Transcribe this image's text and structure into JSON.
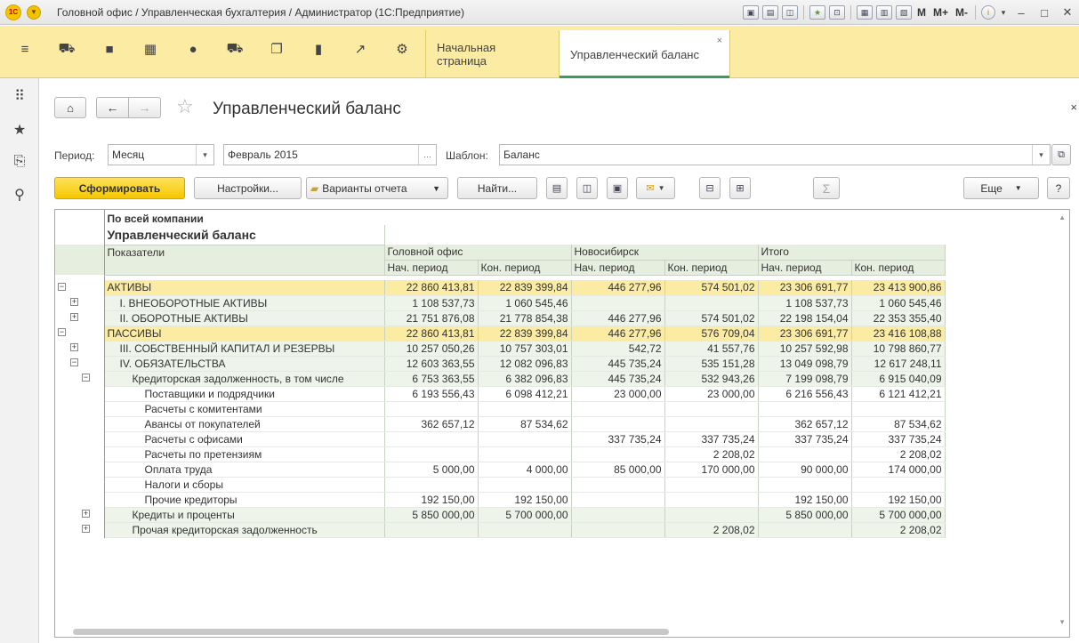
{
  "window": {
    "title": "Головной офис / Управленческая бухгалтерия / Администратор  (1С:Предприятие)",
    "logo_text": "1С",
    "tools": [
      "M",
      "M+",
      "M-"
    ]
  },
  "sections": {
    "tabs": [
      {
        "label": "Начальная страница"
      },
      {
        "label": "Управленческий баланс"
      }
    ]
  },
  "form": {
    "title": "Управленческий баланс",
    "period_label": "Период:",
    "period_type": "Месяц",
    "period_value": "Февраль 2015",
    "template_label": "Шаблон:",
    "template_value": "Баланс",
    "buttons": {
      "generate": "Сформировать",
      "settings": "Настройки...",
      "variants": "Варианты отчета",
      "find": "Найти...",
      "more": "Еще",
      "help": "?"
    }
  },
  "report": {
    "company": "По всей компании",
    "title": "Управленческий баланс",
    "indicators_header": "Показатели",
    "column_groups": [
      "Головной офис",
      "Новосибирск",
      "Итого"
    ],
    "sub_columns": [
      "Нач. период",
      "Кон. период"
    ],
    "rows": [
      {
        "label": "АКТИВЫ",
        "values": [
          "22 860 413,81",
          "22 839 399,84",
          "446 277,96",
          "574 501,02",
          "23 306 691,77",
          "23 413 900,86"
        ]
      },
      {
        "label": "I. ВНЕОБОРОТНЫЕ АКТИВЫ",
        "values": [
          "1 108 537,73",
          "1 060 545,46",
          "",
          "",
          "1 108 537,73",
          "1 060 545,46"
        ]
      },
      {
        "label": "II. ОБОРОТНЫЕ АКТИВЫ",
        "values": [
          "21 751 876,08",
          "21 778 854,38",
          "446 277,96",
          "574 501,02",
          "22 198 154,04",
          "22 353 355,40"
        ]
      },
      {
        "label": "ПАССИВЫ",
        "values": [
          "22 860 413,81",
          "22 839 399,84",
          "446 277,96",
          "576 709,04",
          "23 306 691,77",
          "23 416 108,88"
        ]
      },
      {
        "label": "III. СОБСТВЕННЫЙ КАПИТАЛ И РЕЗЕРВЫ",
        "values": [
          "10 257 050,26",
          "10 757 303,01",
          "542,72",
          "41 557,76",
          "10 257 592,98",
          "10 798 860,77"
        ]
      },
      {
        "label": "IV. ОБЯЗАТЕЛЬСТВА",
        "values": [
          "12 603 363,55",
          "12 082 096,83",
          "445 735,24",
          "535 151,28",
          "13 049 098,79",
          "12 617 248,11"
        ]
      },
      {
        "label": "Кредиторская задолженность, в том числе",
        "values": [
          "6 753 363,55",
          "6 382 096,83",
          "445 735,24",
          "532 943,26",
          "7 199 098,79",
          "6 915 040,09"
        ]
      },
      {
        "label": "Поставщики и подрядчики",
        "values": [
          "6 193 556,43",
          "6 098 412,21",
          "23 000,00",
          "23 000,00",
          "6 216 556,43",
          "6 121 412,21"
        ]
      },
      {
        "label": "Расчеты с комитентами",
        "values": [
          "",
          "",
          "",
          "",
          "",
          ""
        ]
      },
      {
        "label": "Авансы от покупателей",
        "values": [
          "362 657,12",
          "87 534,62",
          "",
          "",
          "362 657,12",
          "87 534,62"
        ]
      },
      {
        "label": "Расчеты с офисами",
        "values": [
          "",
          "",
          "337 735,24",
          "337 735,24",
          "337 735,24",
          "337 735,24"
        ]
      },
      {
        "label": "Расчеты по претензиям",
        "values": [
          "",
          "",
          "",
          "2 208,02",
          "",
          "2 208,02"
        ]
      },
      {
        "label": "Оплата труда",
        "values": [
          "5 000,00",
          "4 000,00",
          "85 000,00",
          "170 000,00",
          "90 000,00",
          "174 000,00"
        ]
      },
      {
        "label": "Налоги и сборы",
        "values": [
          "",
          "",
          "",
          "",
          "",
          ""
        ]
      },
      {
        "label": "Прочие кредиторы",
        "values": [
          "192 150,00",
          "192 150,00",
          "",
          "",
          "192 150,00",
          "192 150,00"
        ]
      },
      {
        "label": "Кредиты и проценты",
        "values": [
          "5 850 000,00",
          "5 700 000,00",
          "",
          "",
          "5 850 000,00",
          "5 700 000,00"
        ]
      },
      {
        "label": "Прочая кредиторская задолженность",
        "values": [
          "",
          "",
          "",
          "2 208,02",
          "",
          "2 208,02"
        ]
      }
    ]
  }
}
